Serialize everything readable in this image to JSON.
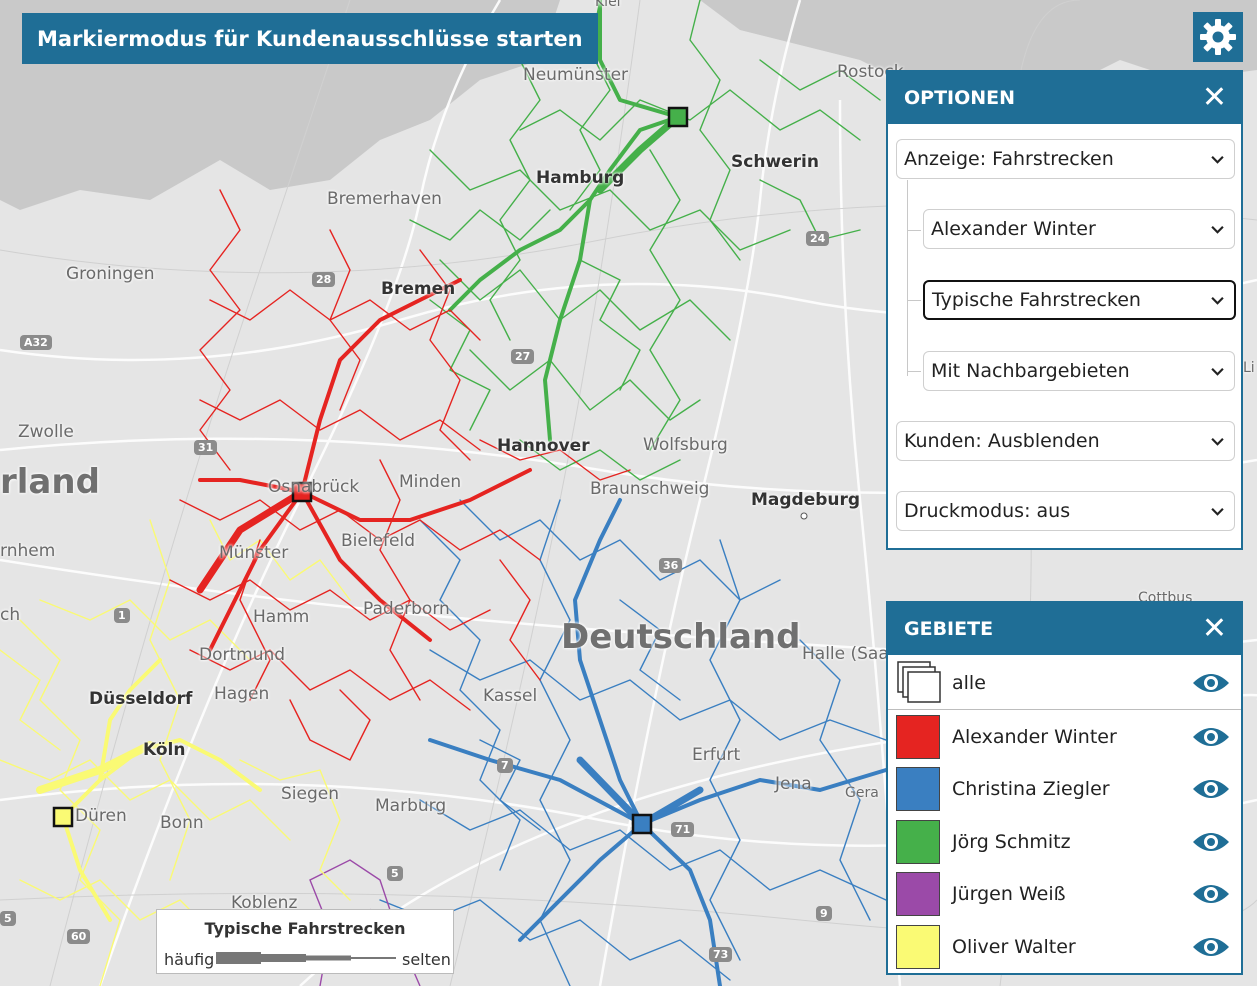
{
  "toolbar": {
    "mark_mode_label": "Markiermodus für Kundenausschlüsse starten",
    "settings_icon": "gear-icon"
  },
  "options": {
    "title": "OPTIONEN",
    "close_icon": "close-icon",
    "display": "Anzeige: Fahrstrecken",
    "person": "Alexander Winter",
    "route_type": "Typische Fahrstrecken",
    "neighbors": "Mit Nachbargebieten",
    "customers": "Kunden: Ausblenden",
    "print_mode": "Druckmodus: aus"
  },
  "areas": {
    "title": "GEBIETE",
    "close_icon": "close-icon",
    "all_label": "alle",
    "items": [
      {
        "name": "Alexander Winter",
        "color": "#e52421"
      },
      {
        "name": "Christina Ziegler",
        "color": "#3a7fc1"
      },
      {
        "name": "Jörg Schmitz",
        "color": "#45b04a"
      },
      {
        "name": "Jürgen Weiß",
        "color": "#9b4aa8"
      },
      {
        "name": "Oliver Walter",
        "color": "#fafa74"
      }
    ]
  },
  "legend": {
    "title": "Typische Fahrstrecken",
    "left_label": "häufig",
    "right_label": "selten"
  },
  "map": {
    "cities": [
      "Neumünster",
      "Rostock",
      "Schwerin",
      "Hamburg",
      "Bremerhaven",
      "Groningen",
      "Bremen",
      "Zwolle",
      "Hannover",
      "Wolfsburg",
      "Osnabrück",
      "Minden",
      "Braunschweig",
      "Magdeburg",
      "Münster",
      "Bielefeld",
      "Hamm",
      "Paderborn",
      "Dortmund",
      "Düsseldorf",
      "Hagen",
      "Kassel",
      "Halle (Saale)",
      "Erfurt",
      "Jena",
      "Köln",
      "Düren",
      "Bonn",
      "Siegen",
      "Marburg",
      "Koblenz",
      "Cottbus",
      "Gera"
    ],
    "country_label": "Deutschland",
    "partial_labels": [
      "Kiel",
      "rland",
      "rnhem",
      "ch",
      "Li"
    ],
    "shields": [
      "A32",
      "28",
      "27",
      "24",
      "31",
      "36",
      "7",
      "71",
      "5",
      "9",
      "73",
      "60",
      "5",
      "1"
    ]
  }
}
